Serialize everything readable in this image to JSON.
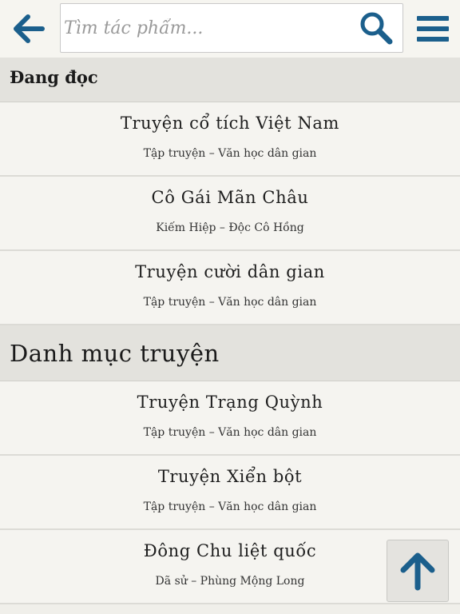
{
  "search": {
    "placeholder": "Tìm tác phẩm..."
  },
  "icons": {
    "back": "arrow-left-icon",
    "search": "magnifier-icon",
    "menu": "hamburger-icon",
    "scroll_top": "arrow-up-icon"
  },
  "colors": {
    "icon": "#1b5f8c",
    "section_bg": "#e3e2dd",
    "item_bg": "#f5f4f0"
  },
  "reading": {
    "heading": "Đang đọc",
    "items": [
      {
        "title": "Truyện cổ tích Việt Nam",
        "subtitle": "Tập truyện – Văn học dân gian"
      },
      {
        "title": "Cô Gái Mãn Châu",
        "subtitle": "Kiếm Hiệp – Độc Cô Hồng"
      },
      {
        "title": "Truyện cười dân gian",
        "subtitle": "Tập truyện – Văn học dân gian"
      }
    ]
  },
  "catalog": {
    "heading": "Danh mục truyện",
    "items": [
      {
        "title": "Truyện Trạng Quỳnh",
        "subtitle": "Tập truyện – Văn học dân gian"
      },
      {
        "title": "Truyện Xiển bột",
        "subtitle": "Tập truyện – Văn học dân gian"
      },
      {
        "title": "Đông Chu liệt quốc",
        "subtitle": "Dã sử – Phùng Mộng Long"
      }
    ]
  }
}
